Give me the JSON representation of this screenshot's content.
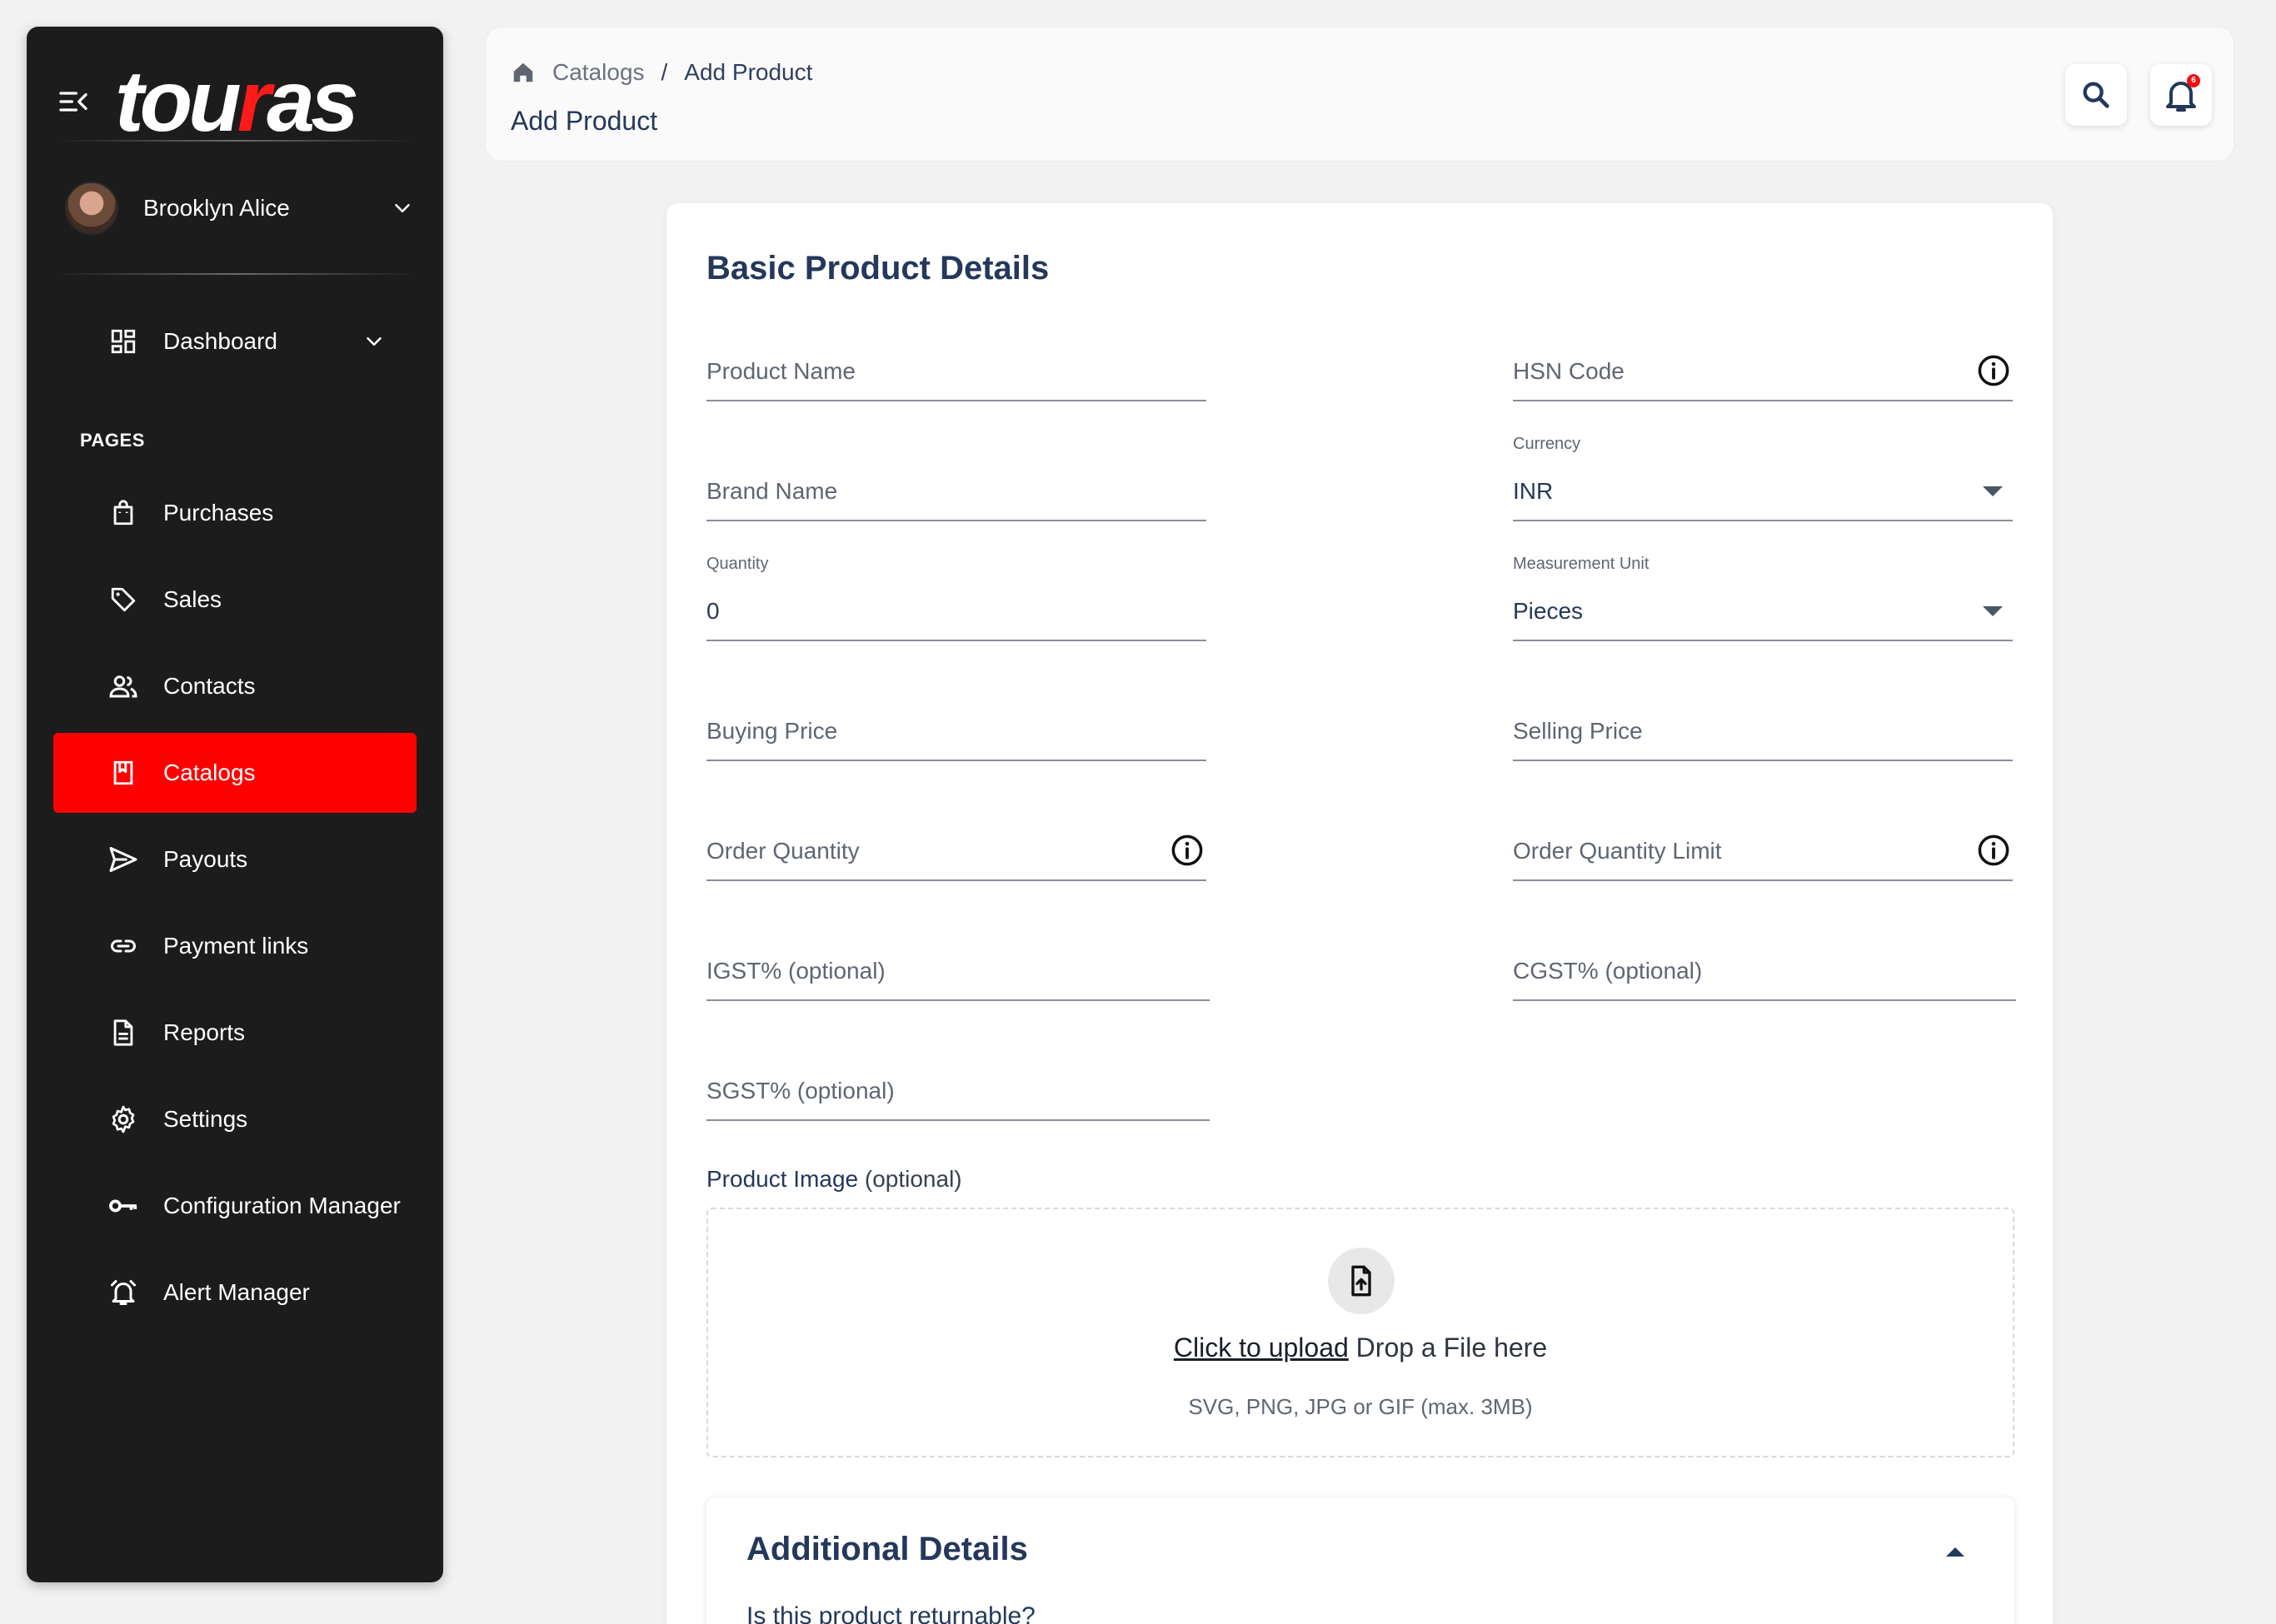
{
  "brand": {
    "logo_text_1": "tou",
    "logo_text_2": "r",
    "logo_text_3": "as",
    "accent_color": "#ff0000"
  },
  "user": {
    "name": "Brooklyn Alice"
  },
  "sidebar": {
    "dashboard": "Dashboard",
    "section_label": "PAGES",
    "items": [
      {
        "label": "Purchases",
        "icon": "shopping-bag-icon"
      },
      {
        "label": "Sales",
        "icon": "tag-icon"
      },
      {
        "label": "Contacts",
        "icon": "people-icon"
      },
      {
        "label": "Catalogs",
        "icon": "book-icon",
        "active": true
      },
      {
        "label": "Payouts",
        "icon": "send-icon"
      },
      {
        "label": "Payment links",
        "icon": "link-icon"
      },
      {
        "label": "Reports",
        "icon": "document-icon"
      },
      {
        "label": "Settings",
        "icon": "gear-icon"
      },
      {
        "label": "Configuration Manager",
        "icon": "key-icon"
      },
      {
        "label": "Alert Manager",
        "icon": "alarm-icon"
      }
    ]
  },
  "header": {
    "breadcrumb": {
      "parent": "Catalogs",
      "separator": "/",
      "current": "Add Product"
    },
    "title": "Add Product",
    "notification_count": "6"
  },
  "form": {
    "title": "Basic Product Details",
    "product_name": {
      "placeholder": "Product Name"
    },
    "hsn_code": {
      "placeholder": "HSN Code"
    },
    "brand_name": {
      "placeholder": "Brand Name"
    },
    "currency": {
      "label": "Currency",
      "value": "INR"
    },
    "quantity": {
      "label": "Quantity",
      "value": "0"
    },
    "measurement_unit": {
      "label": "Measurement Unit",
      "value": "Pieces"
    },
    "buying_price": {
      "placeholder": "Buying Price"
    },
    "selling_price": {
      "placeholder": "Selling Price"
    },
    "order_quantity": {
      "placeholder": "Order Quantity"
    },
    "order_quantity_limit": {
      "placeholder": "Order Quantity Limit"
    },
    "igst": {
      "placeholder": "IGST% (optional)"
    },
    "cgst": {
      "placeholder": "CGST% (optional)"
    },
    "sgst": {
      "placeholder": "SGST% (optional)"
    },
    "product_image": {
      "label": "Product Image",
      "optional": "(optional)",
      "upload_link": "Click to upload",
      "drop_text": " Drop a File here",
      "hint": "SVG, PNG, JPG or GIF (max. 3MB)"
    }
  },
  "additional": {
    "title": "Additional Details",
    "question": "Is this product returnable?"
  }
}
